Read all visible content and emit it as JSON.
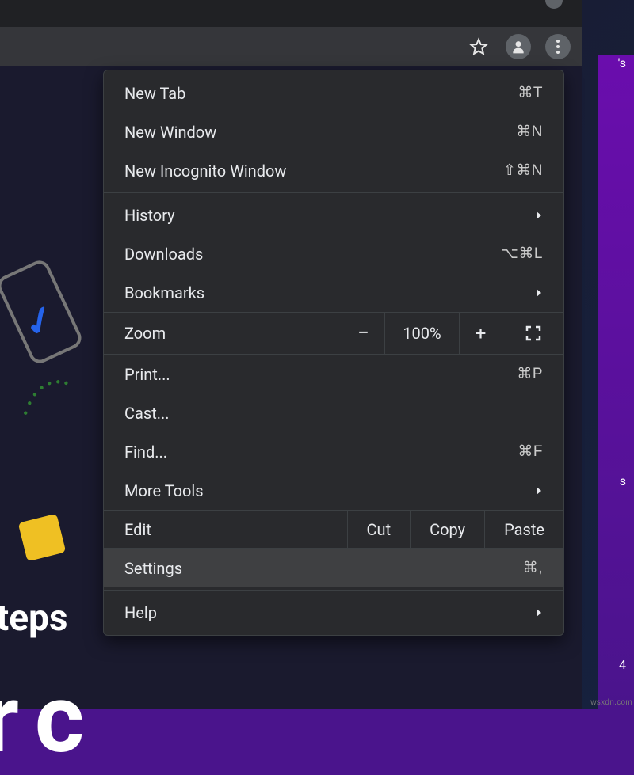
{
  "toolbar": {
    "icons": [
      "star",
      "profile",
      "menu"
    ]
  },
  "menu": {
    "new_tab": {
      "label": "New Tab",
      "shortcut": "⌘T"
    },
    "new_window": {
      "label": "New Window",
      "shortcut": "⌘N"
    },
    "new_incognito": {
      "label": "New Incognito Window",
      "shortcut": "⇧⌘N"
    },
    "history": {
      "label": "History"
    },
    "downloads": {
      "label": "Downloads",
      "shortcut": "⌥⌘L"
    },
    "bookmarks": {
      "label": "Bookmarks"
    },
    "zoom": {
      "label": "Zoom",
      "value": "100%",
      "minus": "−",
      "plus": "+"
    },
    "print": {
      "label": "Print...",
      "shortcut": "⌘P"
    },
    "cast": {
      "label": "Cast..."
    },
    "find": {
      "label": "Find...",
      "shortcut": "⌘F"
    },
    "more_tools": {
      "label": "More Tools"
    },
    "edit": {
      "label": "Edit",
      "cut": "Cut",
      "copy": "Copy",
      "paste": "Paste"
    },
    "settings": {
      "label": "Settings",
      "shortcut": "⌘,"
    },
    "help": {
      "label": "Help"
    }
  },
  "bg": {
    "steps": "steps",
    "big": "r c"
  },
  "side": {
    "s1": "'s",
    "s2": "s",
    "n4": "4"
  },
  "watermark": "wsxdn.com"
}
